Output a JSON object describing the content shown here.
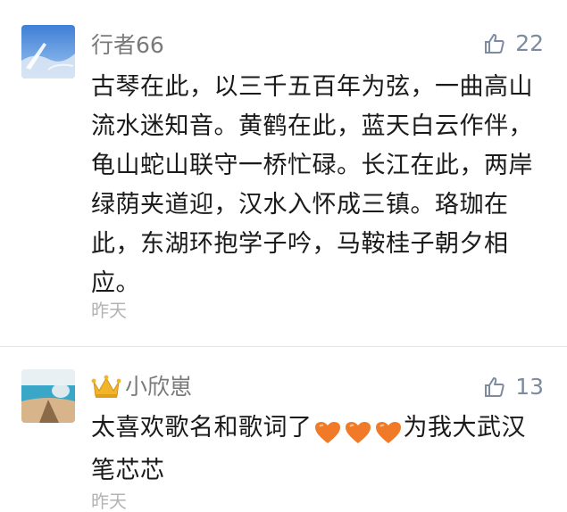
{
  "comments": [
    {
      "username": "行者66",
      "likes": "22",
      "text": "古琴在此，以三千五百年为弦，一曲高山流水迷知音。黄鹤在此，蓝天白云作伴，龟山蛇山联守一桥忙碌。长江在此，两岸绿荫夹道迎，汉水入怀成三镇。珞珈在此，东湖环抱学子吟，马鞍桂子朝夕相应。",
      "time": "昨天",
      "avatar_icon": "sky-avatar-icon"
    },
    {
      "username": "小欣崽",
      "likes": "13",
      "text_before": "太喜欢歌名和歌词了",
      "text_after": "为我大武汉笔芯芯",
      "hearts_count": 3,
      "time": "昨天",
      "avatar_icon": "beach-avatar-icon",
      "badge_icon": "crown-icon"
    }
  ],
  "colors": {
    "username": "#7a7a7a",
    "likes": "#7d8aa0",
    "body_text": "#1a1a1a",
    "time": "#b3b3b3",
    "heart": "#f07a28"
  }
}
